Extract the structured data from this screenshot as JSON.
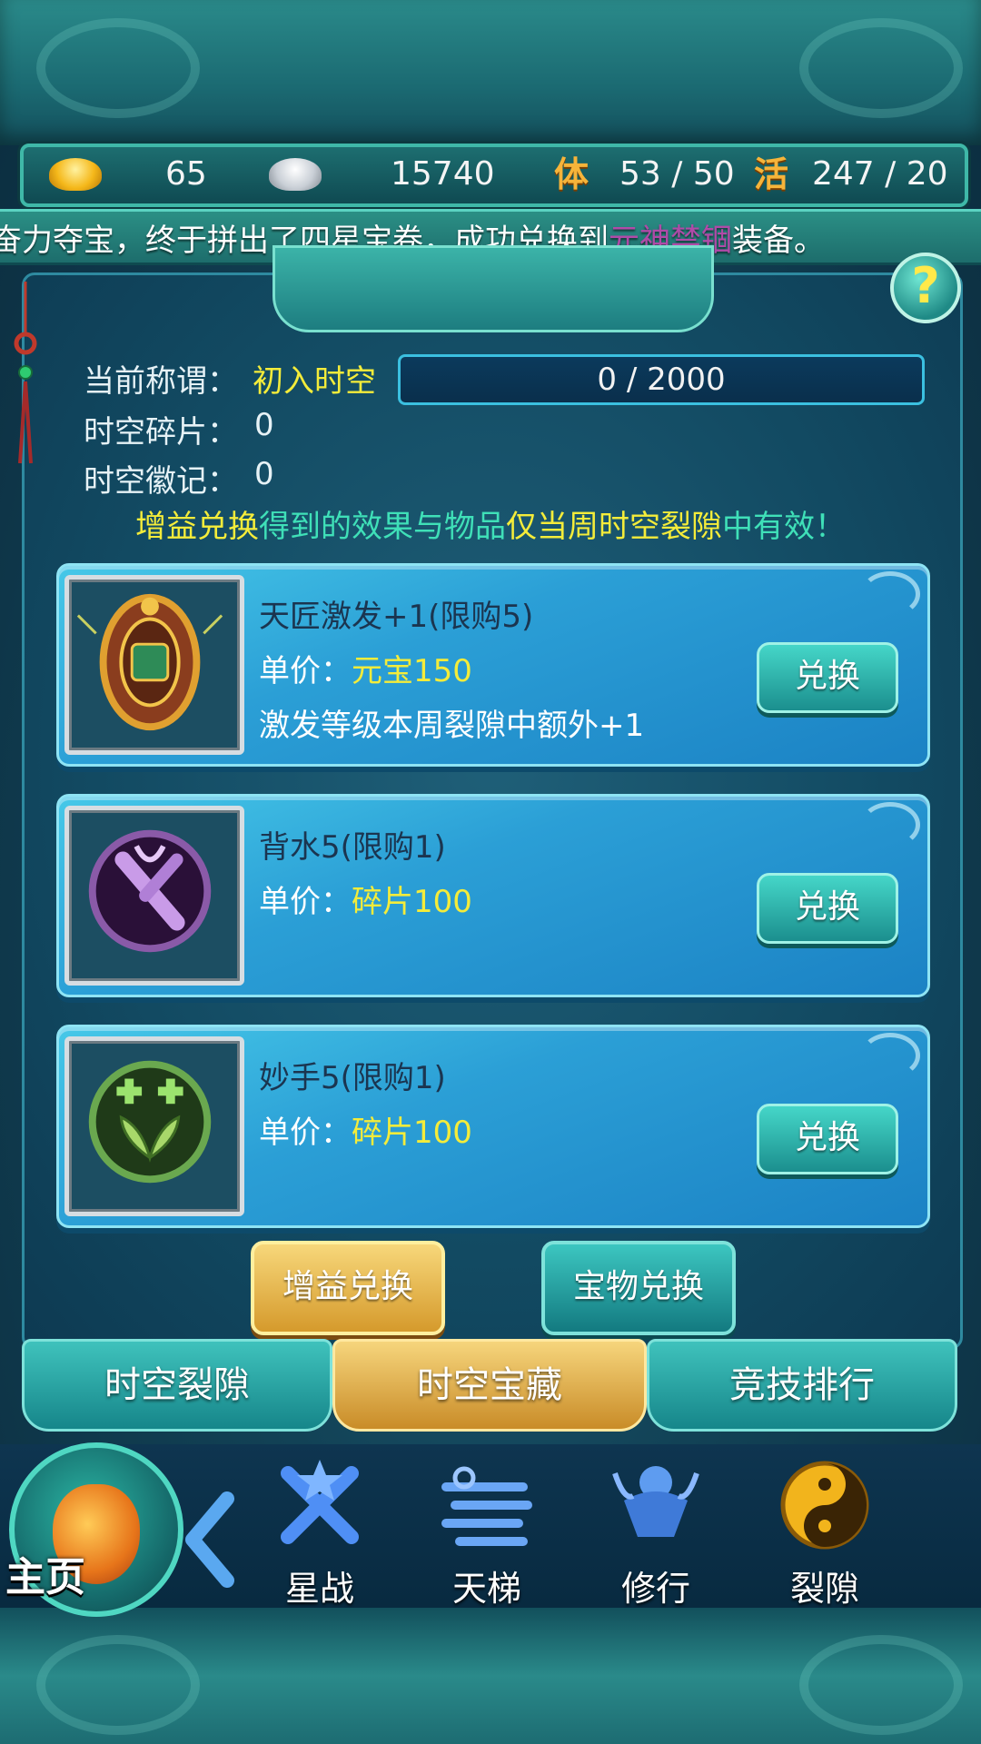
{
  "resources": {
    "gold_icon": "gold-ingot-icon",
    "gold": "65",
    "silver_icon": "silver-ingot-icon",
    "silver": "15740",
    "stamina_label": "体",
    "stamina": "53 / 50",
    "activity_label": "活",
    "activity": "247 / 20"
  },
  "ticker": {
    "before": "奋力夺宝，终于拼出了四星宝卷，成功兑换到",
    "highlight": "元神禁锢",
    "after": "装备。"
  },
  "info": {
    "title_label": "当前称谓：",
    "title_value": "初入时空",
    "progress_text": "0 / 2000",
    "progress_fraction": 0,
    "fragments_label": "时空碎片：",
    "fragments_value": "0",
    "emblems_label": "时空徽记：",
    "emblems_value": "0"
  },
  "notice": {
    "part1": "增益兑换",
    "part2": "得到的效果与物品",
    "part3": "仅当周时空裂隙",
    "part4": "中有效！"
  },
  "items": [
    {
      "icon": "shield-token-icon",
      "title": "天匠激发+1(限购5)",
      "price_label": "单价：",
      "price": "元宝150",
      "desc": "激发等级本周裂隙中额外+1",
      "button": "兑换"
    },
    {
      "icon": "crossed-swords-icon",
      "title": "背水5(限购1)",
      "price_label": "单价：",
      "price": "碎片100",
      "desc": "",
      "button": "兑换"
    },
    {
      "icon": "lotus-heal-icon",
      "title": "妙手5(限购1)",
      "price_label": "单价：",
      "price": "碎片100",
      "desc": "",
      "button": "兑换"
    }
  ],
  "sub_tabs": [
    "增益兑换",
    "宝物兑换"
  ],
  "main_tabs": [
    "时空裂隙",
    "时空宝藏",
    "竞技排行"
  ],
  "nav": {
    "home": "主页",
    "items": [
      {
        "label": "星战",
        "icon": "star-battle-icon"
      },
      {
        "label": "天梯",
        "icon": "sky-ladder-icon"
      },
      {
        "label": "修行",
        "icon": "meditation-icon"
      },
      {
        "label": "裂隙",
        "icon": "yin-yang-icon"
      }
    ]
  },
  "colors": {
    "accent_yellow": "#f4ec3a",
    "notice_green": "#3fe0b8",
    "highlight_purple": "#b04aa8",
    "active_tab_gold": "#d59a2c"
  }
}
